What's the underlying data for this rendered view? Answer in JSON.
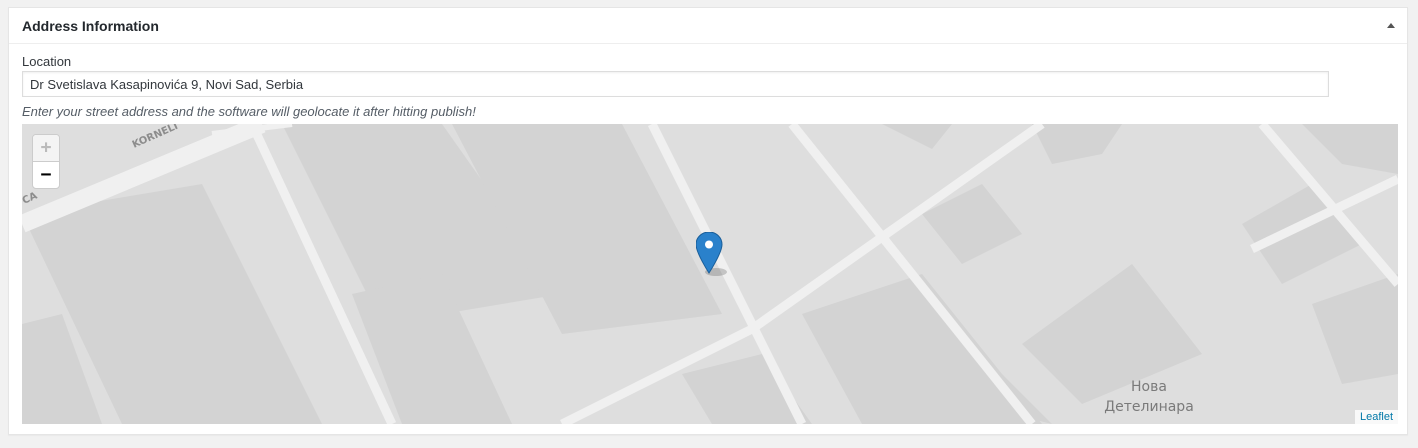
{
  "postbox": {
    "title": "Address Information",
    "toggle_icon": "triangle-up-icon"
  },
  "location": {
    "label": "Location",
    "value": "Dr Svetislava Kasapinovića 9, Novi Sad, Serbia",
    "hint": "Enter your street address and the software will geolocate it after hitting publish!"
  },
  "map": {
    "zoom_in_label": "+",
    "zoom_out_label": "−",
    "attribution": "Leaflet",
    "district_label_line1": "Нова",
    "district_label_line2": "Детелинара",
    "street_label_1": "KORNELI",
    "street_label_2": "CA",
    "marker_color": "#2a81cb",
    "accent_color": "#0078a8"
  }
}
